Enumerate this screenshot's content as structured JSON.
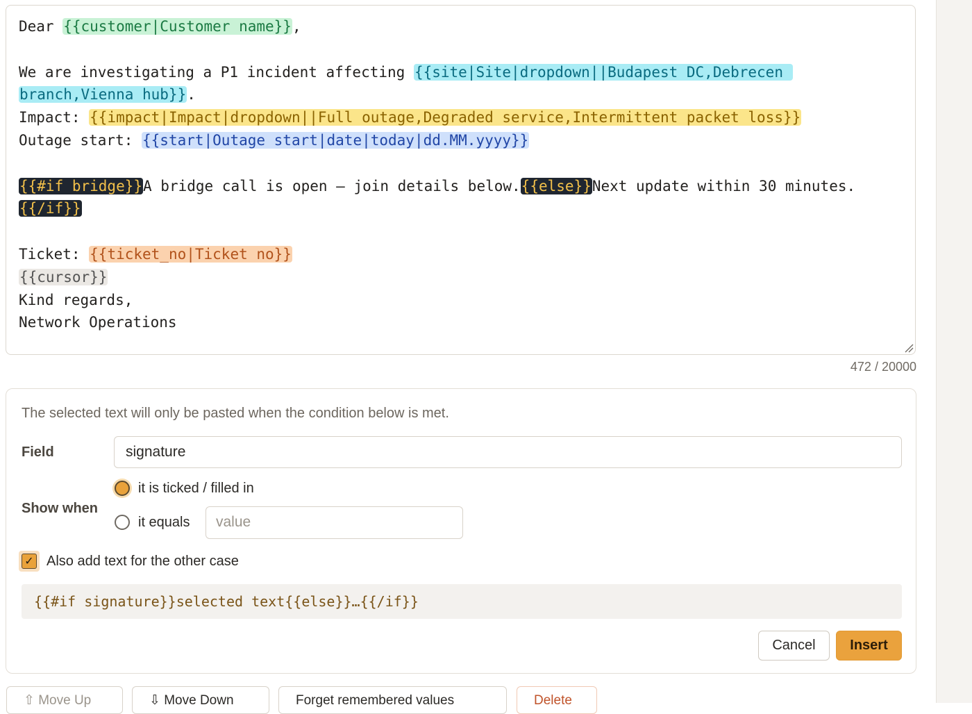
{
  "editor": {
    "lines": [
      [
        {
          "t": "Dear "
        },
        {
          "t": "{{customer|Customer name}}",
          "c": "tk-green"
        },
        {
          "t": ","
        }
      ],
      [],
      [
        {
          "t": "We are investigating a P1 incident affecting "
        },
        {
          "t": "{{site|Site|dropdown||Budapest DC,Debrecen ",
          "c": "tk-cyan"
        }
      ],
      [
        {
          "t": "branch,Vienna hub}}",
          "c": "tk-cyan"
        },
        {
          "t": "."
        }
      ],
      [
        {
          "t": "Impact: "
        },
        {
          "t": "{{impact|Impact|dropdown||Full outage,Degraded service,Intermittent packet loss}}",
          "c": "tk-yellow"
        }
      ],
      [
        {
          "t": "Outage start: "
        },
        {
          "t": "{{start|Outage start|date|today|dd.MM.yyyy}}",
          "c": "tk-blue"
        }
      ],
      [],
      [
        {
          "t": "{{#if bridge}}",
          "c": "tk-dark"
        },
        {
          "t": "A bridge call is open — join details below."
        },
        {
          "t": "{{else}}",
          "c": "tk-dark"
        },
        {
          "t": "Next update within 30 minutes."
        }
      ],
      [
        {
          "t": "{{/if}}",
          "c": "tk-dark"
        }
      ],
      [],
      [
        {
          "t": "Ticket: "
        },
        {
          "t": "{{ticket_no|Ticket no}}",
          "c": "tk-orange"
        }
      ],
      [
        {
          "t": "{{cursor}}",
          "c": "tk-gray"
        }
      ],
      [
        {
          "t": "Kind regards,"
        }
      ],
      [
        {
          "t": "Network Operations"
        }
      ]
    ],
    "counter": "472 / 20000"
  },
  "condition_panel": {
    "note": "The selected text will only be pasted when the condition below is met.",
    "field_label": "Field",
    "field_value": "signature",
    "show_when_label": "Show when",
    "option_ticked": "it is ticked / filled in",
    "option_equals": "it equals",
    "value_placeholder": "value",
    "also_add_label": "Also add text for the other case",
    "preview": "{{#if signature}}selected text{{else}}…{{/if}}",
    "cancel_label": "Cancel",
    "insert_label": "Insert"
  },
  "bottom_buttons": {
    "move_up": "⇧ Move Up",
    "move_down": "⇩ Move Down",
    "forget": "Forget remembered values",
    "delete": "Delete"
  },
  "colors": {
    "accent": "#eaa23d",
    "delete_text": "#c0532a"
  }
}
